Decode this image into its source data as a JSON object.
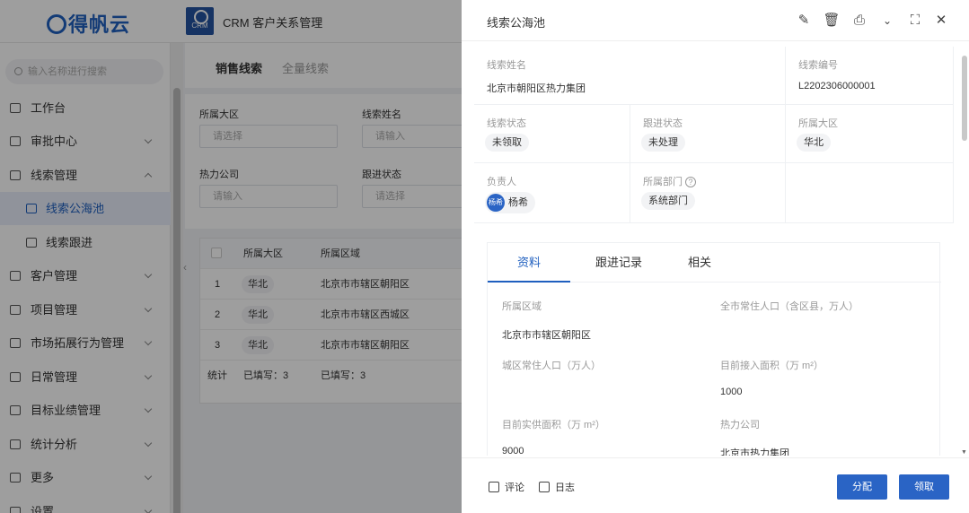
{
  "brand": {
    "logo_text": "得帆云",
    "crm_badge": "CRM",
    "app_title": "CRM 客户关系管理"
  },
  "sidebar": {
    "search_placeholder": "输入名称进行搜索",
    "items": [
      {
        "label": "工作台"
      },
      {
        "label": "审批中心"
      },
      {
        "label": "线索管理"
      },
      {
        "label": "线索公海池"
      },
      {
        "label": "线索跟进"
      },
      {
        "label": "客户管理"
      },
      {
        "label": "项目管理"
      },
      {
        "label": "市场拓展行为管理"
      },
      {
        "label": "日常管理"
      },
      {
        "label": "目标业绩管理"
      },
      {
        "label": "统计分析"
      },
      {
        "label": "更多"
      },
      {
        "label": "设置"
      }
    ]
  },
  "main": {
    "tabs": [
      {
        "label": "销售线索"
      },
      {
        "label": "全量线索"
      }
    ],
    "filters": {
      "region_label": "所属大区",
      "region_placeholder": "请选择",
      "name_label": "线索姓名",
      "name_placeholder": "请输入",
      "company_label": "热力公司",
      "company_placeholder": "请输入",
      "status_label": "跟进状态",
      "status_placeholder": "请选择"
    },
    "table": {
      "headers": [
        "所属大区",
        "所属区域"
      ],
      "rows": [
        {
          "no": "1",
          "region": "华北",
          "area": "北京市市辖区朝阳区"
        },
        {
          "no": "2",
          "region": "华北",
          "area": "北京市市辖区西城区"
        },
        {
          "no": "3",
          "region": "华北",
          "area": "北京市市辖区朝阳区"
        }
      ],
      "footer": {
        "label": "统计",
        "filled1": "已填写：3",
        "filled2": "已填写：3"
      }
    }
  },
  "drawer": {
    "title": "线索公海池",
    "tools": [
      "edit-icon",
      "delete-icon",
      "print-icon",
      "chevron-down-icon",
      "fullscreen-icon",
      "close-icon"
    ],
    "info": {
      "name_label": "线索姓名",
      "name_value": "北京市朝阳区热力集团",
      "code_label": "线索编号",
      "code_value": "L2202306000001",
      "state_label": "线索状态",
      "state_value": "未领取",
      "follow_label": "跟进状态",
      "follow_value": "未处理",
      "region_label": "所属大区",
      "region_value": "华北",
      "owner_label": "负责人",
      "owner_avatar": "杨希",
      "owner_value": "杨希",
      "dept_label": "所属部门",
      "dept_value": "系统部门"
    },
    "detail_tabs": [
      {
        "label": "资料"
      },
      {
        "label": "跟进记录"
      },
      {
        "label": "相关"
      }
    ],
    "fields": {
      "area_label": "所属区域",
      "area_value": "北京市市辖区朝阳区",
      "pop_label": "全市常住人口（含区县，万人）",
      "pop_value": "",
      "urban_pop_label": "城区常住人口（万人）",
      "urban_pop_value": "",
      "access_label": "目前接入面积（万 m²）",
      "access_value": "1000",
      "heat_label": "目前实供面积（万 m²）",
      "heat_value": "9000",
      "company_label": "热力公司",
      "company_value": "北京市热力集团"
    },
    "footer": {
      "comment": "评论",
      "log": "日志",
      "assign": "分配",
      "claim": "领取"
    }
  }
}
